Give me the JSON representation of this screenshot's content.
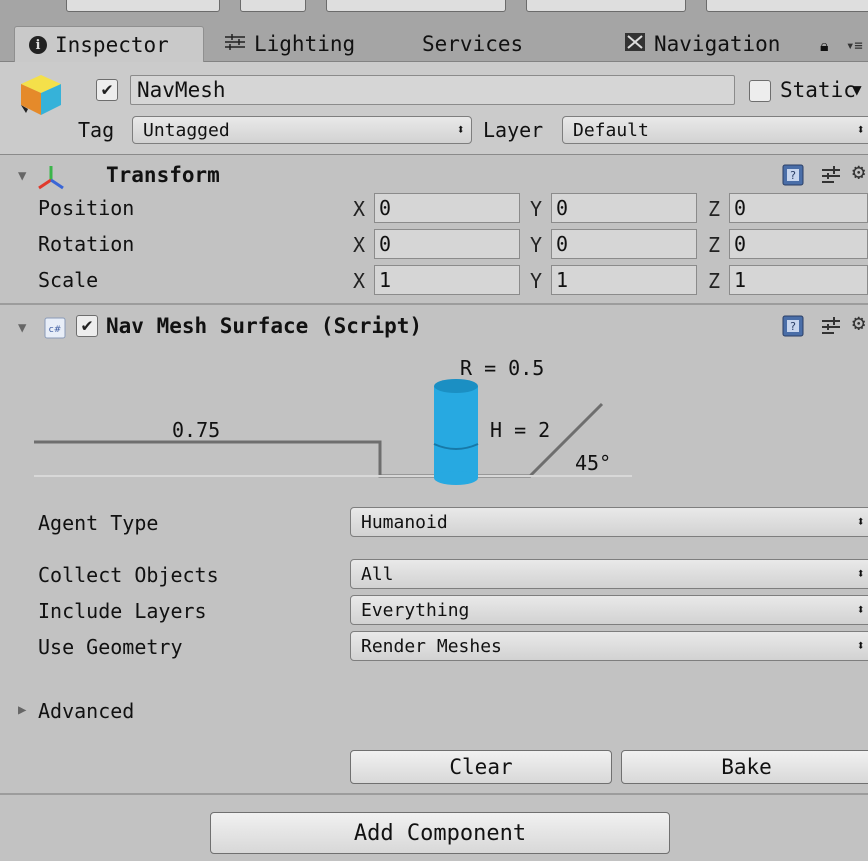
{
  "tabs": [
    {
      "label": "Inspector",
      "icon": "info-icon"
    },
    {
      "label": "Lighting",
      "icon": "lighting-icon"
    },
    {
      "label": "Services",
      "icon": ""
    },
    {
      "label": "Navigation",
      "icon": "navigation-icon"
    }
  ],
  "object": {
    "active": true,
    "name": "NavMesh",
    "static_label": "Static",
    "static_checked": false,
    "tag_label": "Tag",
    "tag_value": "Untagged",
    "layer_label": "Layer",
    "layer_value": "Default"
  },
  "transform": {
    "title": "Transform",
    "rows": [
      {
        "label": "Position",
        "x": "0",
        "y": "0",
        "z": "0"
      },
      {
        "label": "Rotation",
        "x": "0",
        "y": "0",
        "z": "0"
      },
      {
        "label": "Scale",
        "x": "1",
        "y": "1",
        "z": "1"
      }
    ],
    "axis_x": "X",
    "axis_y": "Y",
    "axis_z": "Z"
  },
  "navmesh": {
    "title": "Nav Mesh Surface (Script)",
    "enabled": true,
    "diagram": {
      "radius_label": "R = 0.5",
      "height_label": "H = 2",
      "step_label": "0.75",
      "slope_label": "45°"
    },
    "agent_type_label": "Agent Type",
    "agent_type_value": "Humanoid",
    "collect_objects_label": "Collect Objects",
    "collect_objects_value": "All",
    "include_layers_label": "Include Layers",
    "include_layers_value": "Everything",
    "use_geometry_label": "Use Geometry",
    "use_geometry_value": "Render Meshes",
    "advanced_label": "Advanced",
    "clear_label": "Clear",
    "bake_label": "Bake"
  },
  "add_component_label": "Add Component",
  "colors": {
    "cylinder": "#27a9e1",
    "background": "#c2c2c2"
  }
}
